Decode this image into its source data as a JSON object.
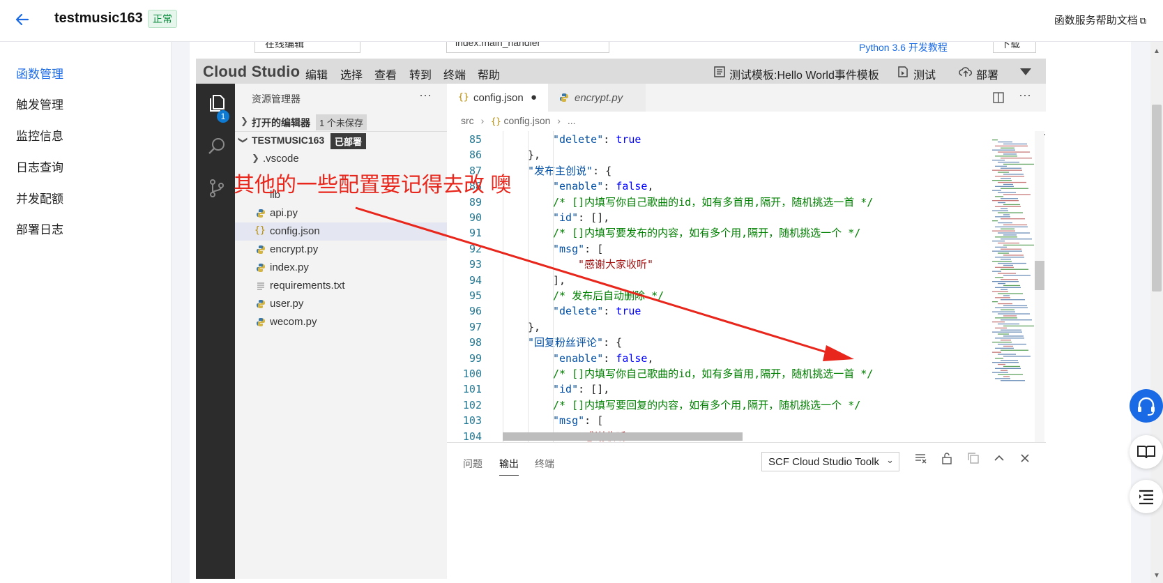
{
  "header": {
    "function_name": "testmusic163",
    "status": "正常",
    "help_link": "函数服务帮助文档"
  },
  "sidebar": {
    "items": [
      {
        "label": "函数管理",
        "active": true
      },
      {
        "label": "触发管理"
      },
      {
        "label": "监控信息"
      },
      {
        "label": "日志查询"
      },
      {
        "label": "并发配额"
      },
      {
        "label": "部署日志"
      }
    ]
  },
  "config_strip": {
    "upload_value": "在线编辑",
    "handler_value": "index.main_handler",
    "link_text": "Python 3.6 开发教程",
    "button_value": "下载"
  },
  "cloud_studio": {
    "logo": "Cloud Studio",
    "menu": [
      "编辑",
      "选择",
      "查看",
      "转到",
      "终端",
      "帮助"
    ],
    "test_template": "测试模板:Hello World事件模板",
    "test_label": "测试",
    "deploy_label": "部署"
  },
  "activity_bar": {
    "explorer_badge": "1"
  },
  "explorer": {
    "title": "资源管理器",
    "open_editors_label": "打开的编辑器",
    "unsaved_badge": "1 个未保存",
    "project_name": "TESTMUSIC163",
    "deployed_badge": "已部署",
    "items": [
      {
        "name": ".vscode",
        "kind": "folder"
      },
      {
        "name": "lib",
        "kind": "folder"
      },
      {
        "name": "api.py",
        "kind": "python"
      },
      {
        "name": "config.json",
        "kind": "json",
        "selected": true
      },
      {
        "name": "encrypt.py",
        "kind": "python"
      },
      {
        "name": "index.py",
        "kind": "python"
      },
      {
        "name": "requirements.txt",
        "kind": "text"
      },
      {
        "name": "user.py",
        "kind": "python"
      },
      {
        "name": "wecom.py",
        "kind": "python"
      }
    ]
  },
  "tabs": [
    {
      "label": "config.json",
      "active": true,
      "modified": true
    },
    {
      "label": "encrypt.py",
      "active": false
    }
  ],
  "breadcrumb": {
    "parts": [
      "src",
      "config.json",
      "..."
    ]
  },
  "code_lines": [
    {
      "n": "85",
      "indent": 4,
      "parts": [
        [
          "k",
          "\"delete\""
        ],
        [
          "p",
          ": "
        ],
        [
          "b",
          "true"
        ]
      ]
    },
    {
      "n": "86",
      "indent": 3,
      "parts": [
        [
          "p",
          "},"
        ]
      ]
    },
    {
      "n": "87",
      "indent": 3,
      "parts": [
        [
          "k",
          "\"发布主创说\""
        ],
        [
          "p",
          ": {"
        ]
      ]
    },
    {
      "n": "88",
      "indent": 4,
      "parts": [
        [
          "k",
          "\"enable\""
        ],
        [
          "p",
          ": "
        ],
        [
          "b",
          "false"
        ],
        [
          "p",
          ","
        ]
      ]
    },
    {
      "n": "89",
      "indent": 4,
      "parts": [
        [
          "c",
          "/* []内填写你自己歌曲的id，如有多首用,隔开，随机挑选一首 */"
        ]
      ]
    },
    {
      "n": "90",
      "indent": 4,
      "parts": [
        [
          "k",
          "\"id\""
        ],
        [
          "p",
          ": [],"
        ]
      ]
    },
    {
      "n": "91",
      "indent": 4,
      "parts": [
        [
          "c",
          "/* []内填写要发布的内容，如有多个用,隔开，随机挑选一个 */"
        ]
      ]
    },
    {
      "n": "92",
      "indent": 4,
      "parts": [
        [
          "k",
          "\"msg\""
        ],
        [
          "p",
          ": ["
        ]
      ]
    },
    {
      "n": "93",
      "indent": 5,
      "parts": [
        [
          "s",
          "\"感谢大家收听\""
        ]
      ]
    },
    {
      "n": "94",
      "indent": 4,
      "parts": [
        [
          "p",
          "],"
        ]
      ]
    },
    {
      "n": "95",
      "indent": 4,
      "parts": [
        [
          "c",
          "/* 发布后自动删除 */"
        ]
      ]
    },
    {
      "n": "96",
      "indent": 4,
      "parts": [
        [
          "k",
          "\"delete\""
        ],
        [
          "p",
          ": "
        ],
        [
          "b",
          "true"
        ]
      ]
    },
    {
      "n": "97",
      "indent": 3,
      "parts": [
        [
          "p",
          "},"
        ]
      ]
    },
    {
      "n": "98",
      "indent": 3,
      "parts": [
        [
          "k",
          "\"回复粉丝评论\""
        ],
        [
          "p",
          ": {"
        ]
      ]
    },
    {
      "n": "99",
      "indent": 4,
      "parts": [
        [
          "k",
          "\"enable\""
        ],
        [
          "p",
          ": "
        ],
        [
          "b",
          "false"
        ],
        [
          "p",
          ","
        ]
      ]
    },
    {
      "n": "100",
      "indent": 4,
      "parts": [
        [
          "c",
          "/* []内填写你自己歌曲的id，如有多首用,隔开，随机挑选一首 */"
        ]
      ]
    },
    {
      "n": "101",
      "indent": 4,
      "parts": [
        [
          "k",
          "\"id\""
        ],
        [
          "p",
          ": [],"
        ]
      ]
    },
    {
      "n": "102",
      "indent": 4,
      "parts": [
        [
          "c",
          "/* []内填写要回复的内容，如有多个用,隔开，随机挑选一个 */"
        ]
      ]
    },
    {
      "n": "103",
      "indent": 4,
      "parts": [
        [
          "k",
          "\"msg\""
        ],
        [
          "p",
          ": ["
        ]
      ]
    },
    {
      "n": "104",
      "indent": 5,
      "parts": [
        [
          "s",
          "\"感谢收听\""
        ]
      ]
    }
  ],
  "bottom_panel": {
    "tabs": [
      {
        "label": "问题"
      },
      {
        "label": "输出",
        "active": true
      },
      {
        "label": "终端"
      }
    ],
    "channel": "SCF Cloud Studio Toolk"
  },
  "annotation": {
    "text": "其他的一些配置要记得去改 噢",
    "color": "#e8261b"
  },
  "colors": {
    "accent": "#1a6ae6",
    "status_green": "#0a8a3c",
    "float_button_blue": "#1a6ae6"
  }
}
